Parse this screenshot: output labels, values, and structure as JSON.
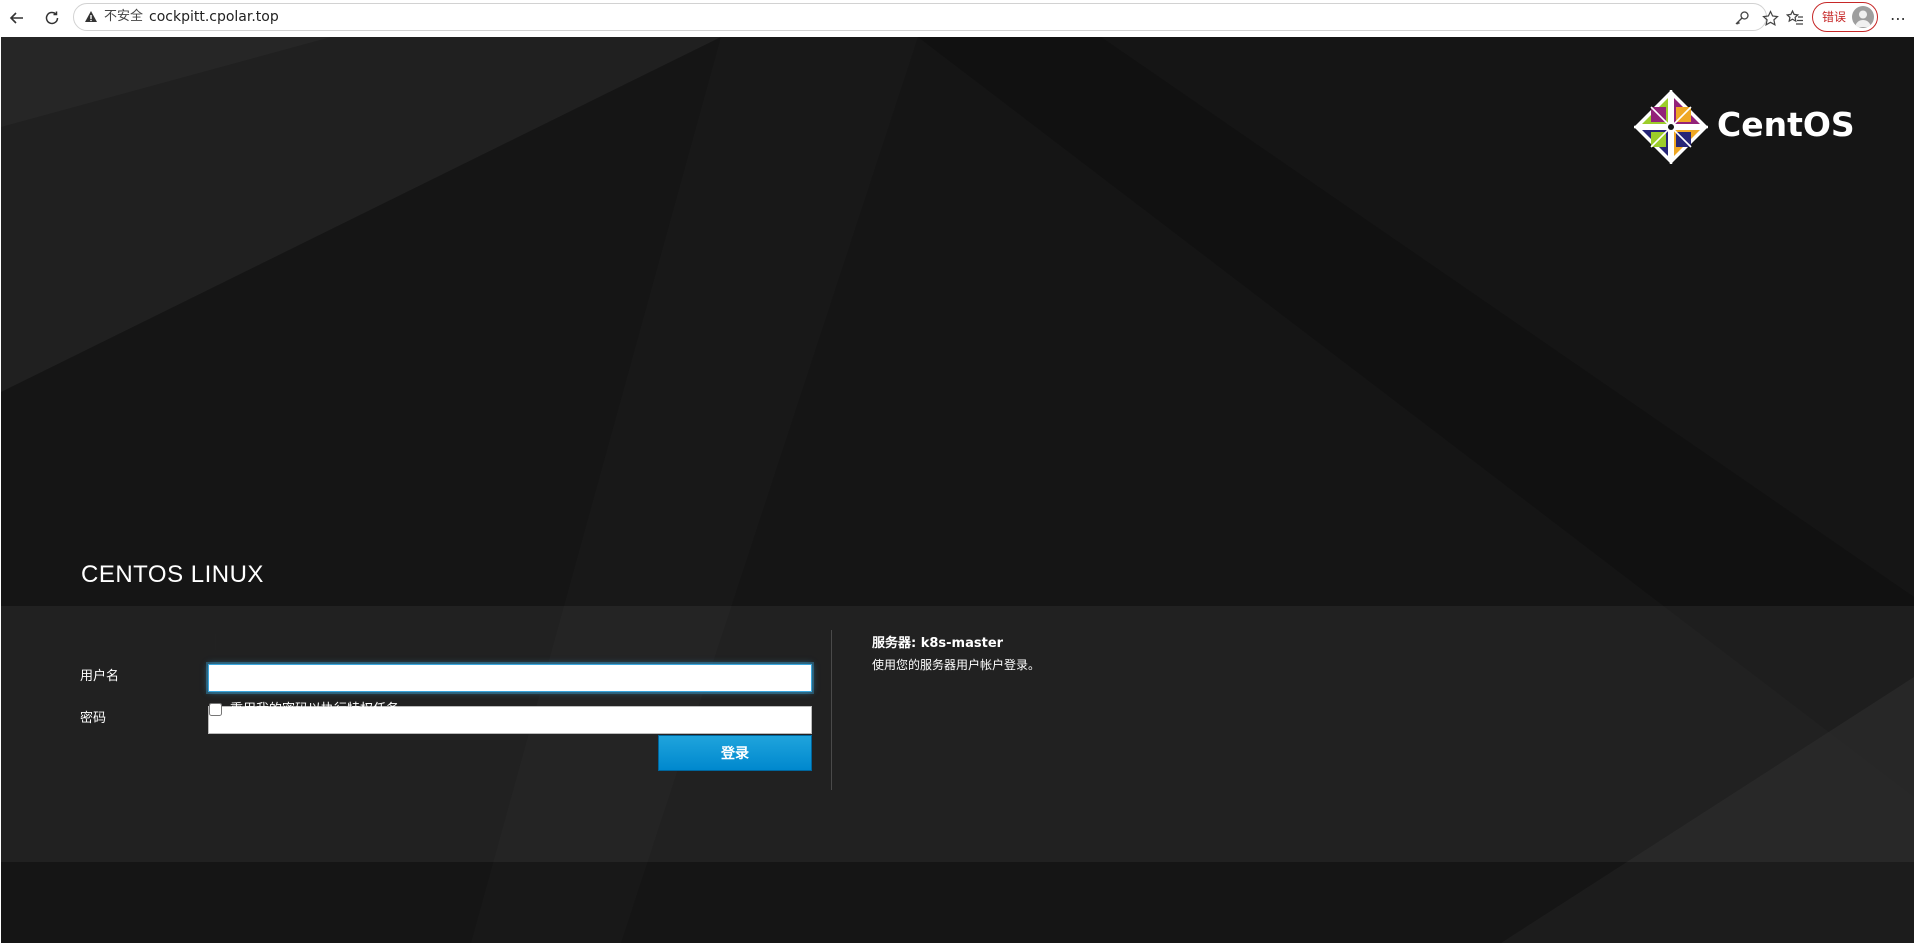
{
  "browser": {
    "security_label": "不安全",
    "url": "cockpitt.cpolar.top",
    "profile_label": "错误",
    "more_label": "⋯"
  },
  "page": {
    "brand_logo_text": "CentOS",
    "os_title": "CENTOS LINUX",
    "username_label": "用户名",
    "username_value": "",
    "password_label": "密码",
    "password_value": "",
    "reuse_password_label": "重用我的密码以执行特权任务",
    "reuse_password_checked": false,
    "login_button": "登录",
    "server_prefix": "服务器:",
    "server_name": "k8s-master",
    "server_hint": "使用您的服务器用户帐户登录。"
  },
  "colors": {
    "accent": "#0088ce",
    "page_background": "#151515",
    "error_badge": "#c62828"
  }
}
